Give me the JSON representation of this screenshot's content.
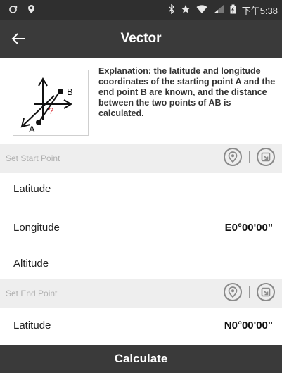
{
  "status_bar": {
    "time": "下午5:38"
  },
  "app_bar": {
    "title": "Vector"
  },
  "explanation": {
    "text": "Explanation: the latitude and longitude coordinates of the starting point A and the end point B are known, and the distance between the two points of AB is calculated.",
    "diagram": {
      "label_a": "A",
      "label_b": "B",
      "label_q": "?"
    }
  },
  "start_section": {
    "title": "Set Start Point",
    "rows": [
      {
        "label": "Latitude",
        "value": ""
      },
      {
        "label": "Longitude",
        "value": "E0°00'00\""
      },
      {
        "label": "Altitude",
        "value": ""
      }
    ]
  },
  "end_section": {
    "title": "Set End Point",
    "rows": [
      {
        "label": "Latitude",
        "value": "N0°00'00\""
      }
    ]
  },
  "calculate_button": {
    "label": "Calculate"
  },
  "icons": {
    "location": "location-pin-icon",
    "import": "import-icon"
  },
  "colors": {
    "app_bar": "#3a3a3a",
    "section_bg": "#eeeeee",
    "accent_red": "#d9262c"
  }
}
